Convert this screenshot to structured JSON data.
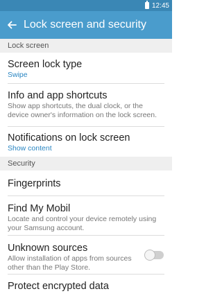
{
  "status_bar": {
    "time": "12:45",
    "battery_icon": "battery-icon"
  },
  "app_bar": {
    "back_icon": "arrow-left-icon",
    "title": "Lock screen and security"
  },
  "sections": {
    "lock_screen": {
      "header": "Lock screen",
      "items": [
        {
          "title": "Screen lock type",
          "value": "Swipe"
        },
        {
          "title": "Info and app shortcuts",
          "description": "Show app shortcuts, the dual clock, or the device owner's information on the lock screen."
        },
        {
          "title": "Notifications on lock screen",
          "value": "Show content"
        }
      ]
    },
    "security": {
      "header": "Security",
      "items": [
        {
          "title": "Fingerprints"
        },
        {
          "title": "Find My Mobil",
          "description": "Locate and control your device remotely using your Samsung account."
        },
        {
          "title": "Unknown sources",
          "description": "Allow installation of apps from sources other than the Play Store.",
          "toggle": "off"
        },
        {
          "title": "Protect encrypted data"
        }
      ]
    }
  },
  "colors": {
    "status_bar": "#3a87b5",
    "app_bar": "#4a9ccc",
    "accent_text": "#2a86c2"
  }
}
